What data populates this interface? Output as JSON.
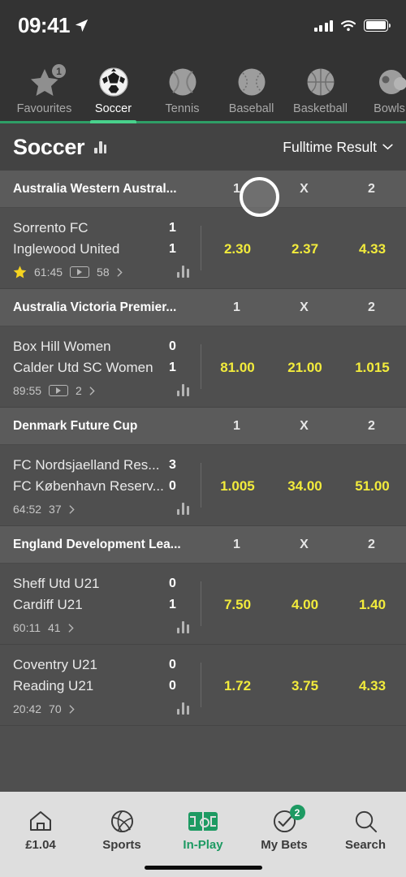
{
  "status_bar": {
    "time": "09:41",
    "location_icon": "location-arrow-icon",
    "signal_icon": "cellular-signal-icon",
    "wifi_icon": "wifi-icon",
    "battery_icon": "battery-full-icon"
  },
  "sport_tabs": [
    {
      "label": "Favourites",
      "icon": "star-icon",
      "badge": "1",
      "active": false
    },
    {
      "label": "Soccer",
      "icon": "soccer-ball-icon",
      "badge": null,
      "active": true
    },
    {
      "label": "Tennis",
      "icon": "tennis-ball-icon",
      "badge": null,
      "active": false
    },
    {
      "label": "Baseball",
      "icon": "baseball-icon",
      "badge": null,
      "active": false
    },
    {
      "label": "Basketball",
      "icon": "basketball-icon",
      "badge": null,
      "active": false
    },
    {
      "label": "Bowls",
      "icon": "bowls-icon",
      "badge": null,
      "active": false
    }
  ],
  "page_header": {
    "title": "Soccer",
    "stats_icon": "bar-chart-icon",
    "market_selector": "Fulltime Result",
    "chevron_icon": "chevron-down-icon"
  },
  "columns": [
    "1",
    "X",
    "2"
  ],
  "groups": [
    {
      "league": "Australia Western Austral...",
      "matches": [
        {
          "home": "Sorrento FC",
          "home_score": "1",
          "away": "Inglewood United",
          "away_score": "1",
          "favourite": true,
          "time": "61:45",
          "has_video": true,
          "count": "58",
          "odds": [
            "2.30",
            "2.37",
            "4.33"
          ]
        }
      ]
    },
    {
      "league": "Australia Victoria Premier...",
      "matches": [
        {
          "home": "Box Hill Women",
          "home_score": "0",
          "away": "Calder Utd SC Women",
          "away_score": "1",
          "favourite": false,
          "time": "89:55",
          "has_video": true,
          "count": "2",
          "odds": [
            "81.00",
            "21.00",
            "1.015"
          ]
        }
      ]
    },
    {
      "league": "Denmark Future Cup",
      "matches": [
        {
          "home": "FC Nordsjaelland Res...",
          "home_score": "3",
          "away": "FC København Reserv...",
          "away_score": "0",
          "favourite": false,
          "time": "64:52",
          "has_video": false,
          "count": "37",
          "odds": [
            "1.005",
            "34.00",
            "51.00"
          ]
        }
      ]
    },
    {
      "league": "England Development Lea...",
      "matches": [
        {
          "home": "Sheff Utd U21",
          "home_score": "0",
          "away": "Cardiff U21",
          "away_score": "1",
          "favourite": false,
          "time": "60:11",
          "has_video": false,
          "count": "41",
          "odds": [
            "7.50",
            "4.00",
            "1.40"
          ]
        },
        {
          "home": "Coventry U21",
          "home_score": "0",
          "away": "Reading U21",
          "away_score": "0",
          "favourite": false,
          "time": "20:42",
          "has_video": false,
          "count": "70",
          "odds": [
            "1.72",
            "3.75",
            "4.33"
          ]
        }
      ]
    }
  ],
  "bottom_nav": [
    {
      "label": "£1.04",
      "icon": "home-icon",
      "badge": null,
      "active": false
    },
    {
      "label": "Sports",
      "icon": "volleyball-icon",
      "badge": null,
      "active": false
    },
    {
      "label": "In-Play",
      "icon": "pitch-icon",
      "badge": null,
      "active": true
    },
    {
      "label": "My Bets",
      "icon": "check-circle-icon",
      "badge": "2",
      "active": false
    },
    {
      "label": "Search",
      "icon": "search-icon",
      "badge": null,
      "active": false
    }
  ],
  "cursor": {
    "name": "touch-cursor-indicator"
  },
  "colors": {
    "accent_green": "#1d9a62",
    "odds_yellow": "#f2eb3c",
    "star_gold": "#f5d320",
    "row_bg": "#4f4f4f",
    "league_bg": "#5b5b5b",
    "chrome_bg": "#333333"
  }
}
